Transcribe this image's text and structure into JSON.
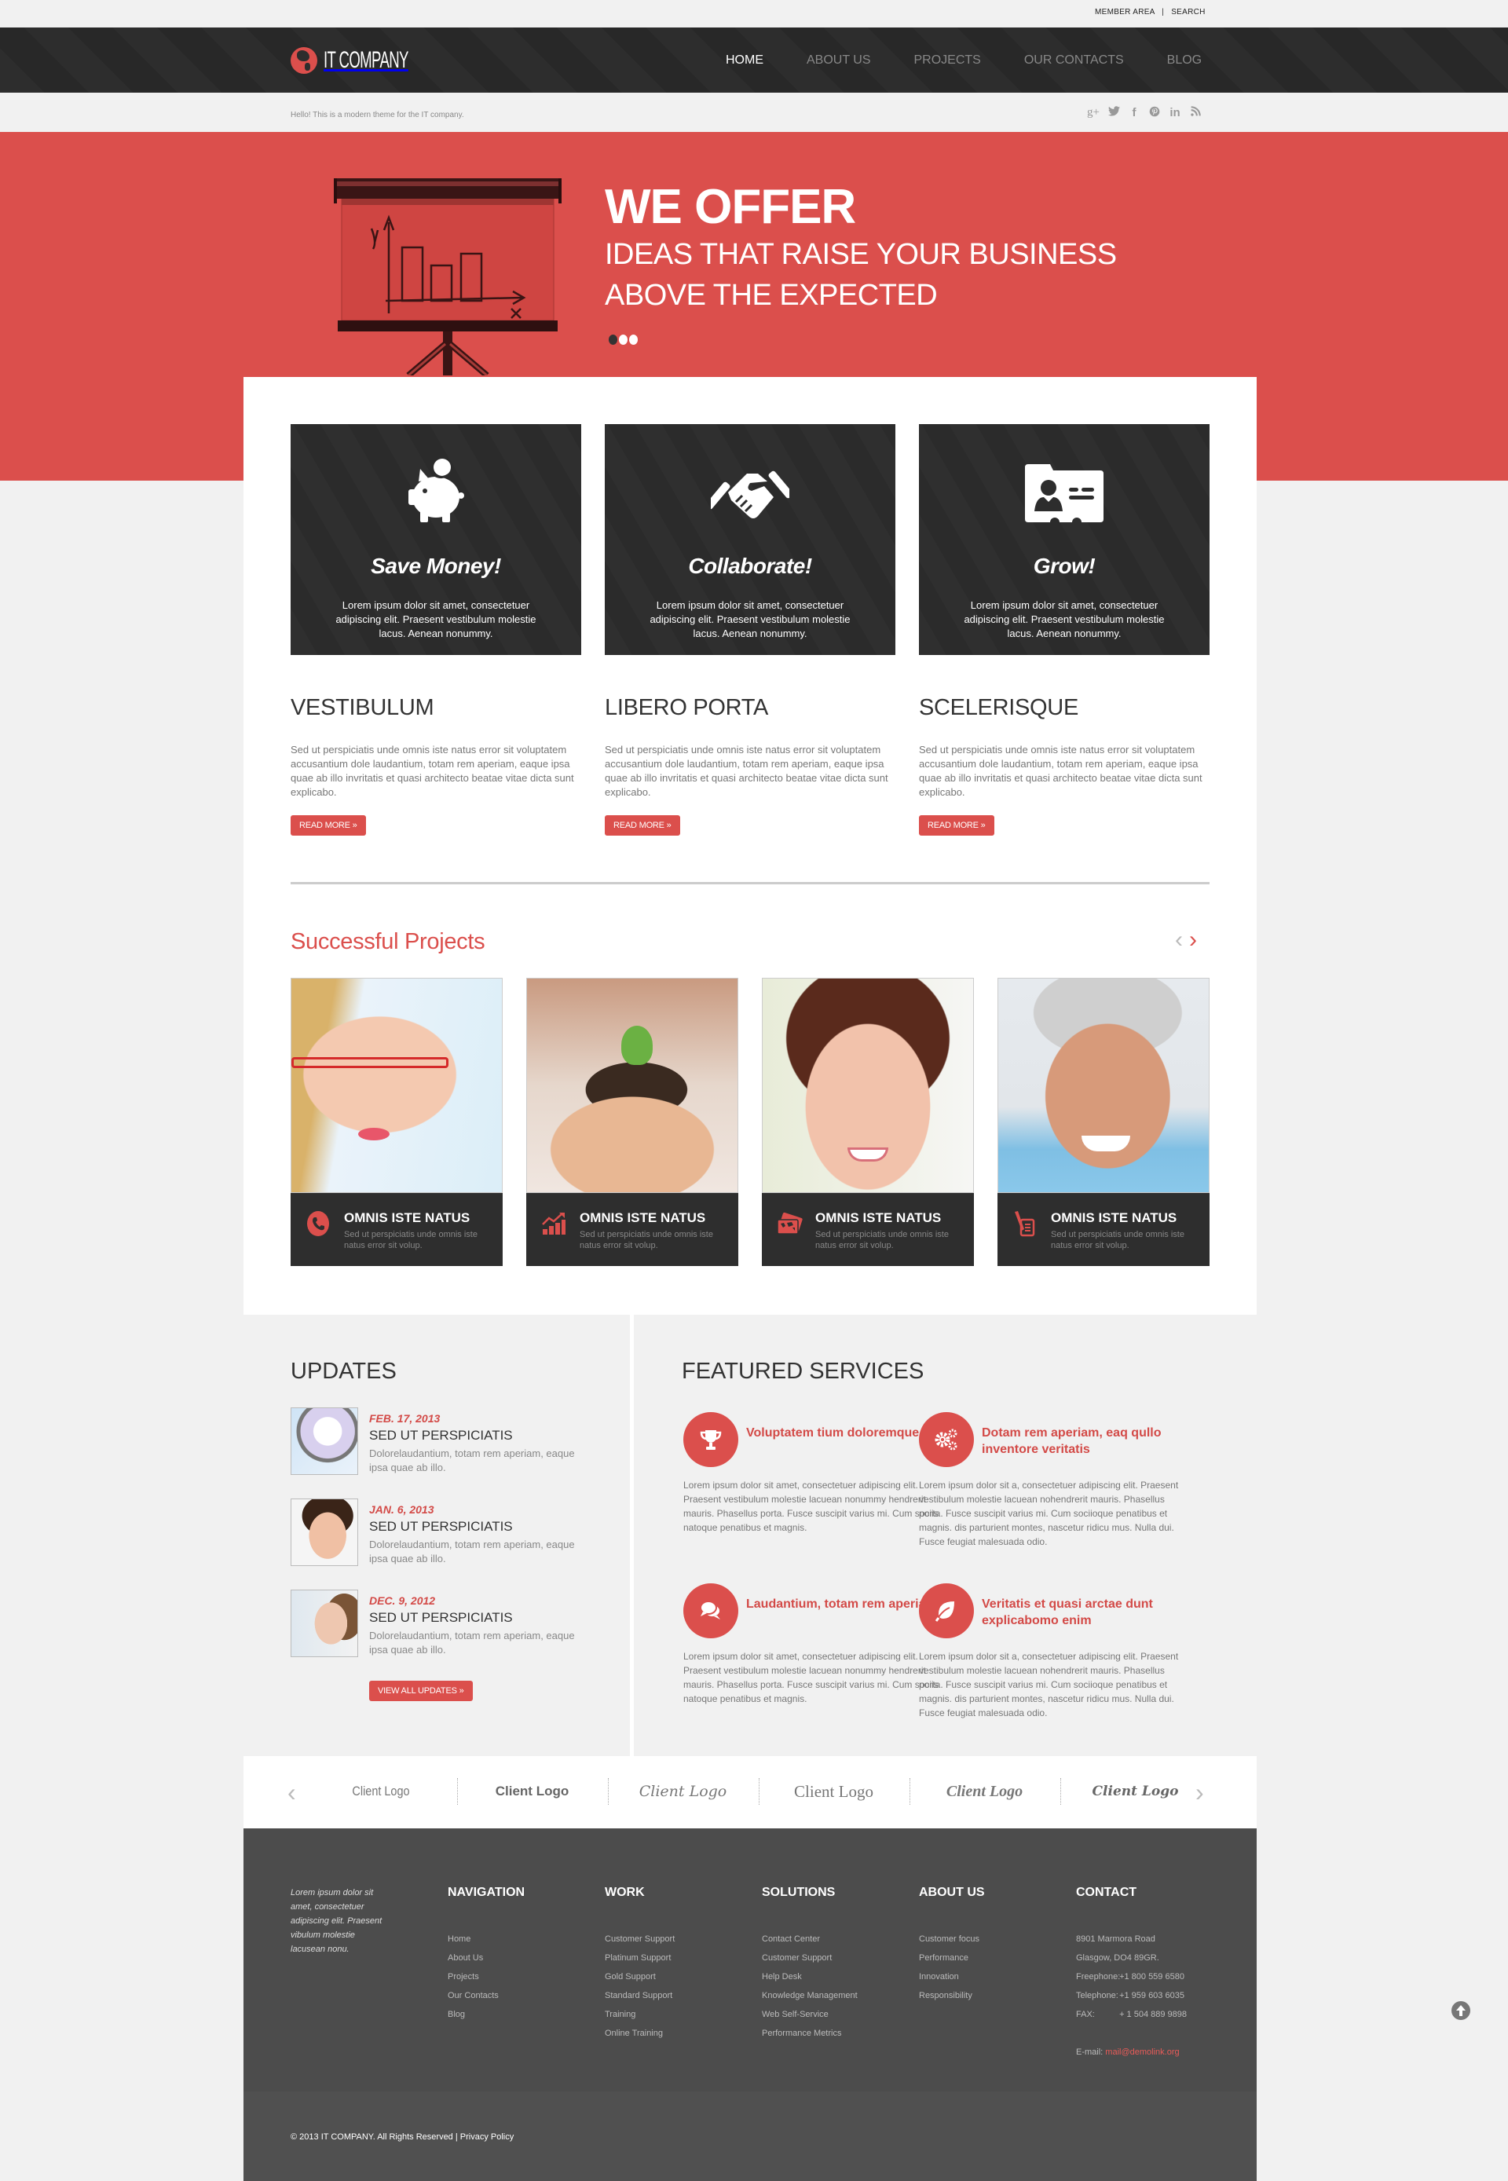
{
  "top_links": {
    "member_area": "MEMBER AREA",
    "separator": "|",
    "search": "SEARCH"
  },
  "header": {
    "logo_text": "IT COMPANY",
    "nav": [
      {
        "label": "HOME",
        "active": true
      },
      {
        "label": "ABOUT US",
        "active": false
      },
      {
        "label": "PROJECTS",
        "active": false
      },
      {
        "label": "OUR CONTACTS",
        "active": false
      },
      {
        "label": "BLOG",
        "active": false
      }
    ],
    "tagline": "Hello! This is a modern theme for the IT company.",
    "social": [
      {
        "icon": "google-plus-icon",
        "glyph": "g+"
      },
      {
        "icon": "twitter-icon",
        "glyph": "t"
      },
      {
        "icon": "facebook-icon",
        "glyph": "f"
      },
      {
        "icon": "pinterest-icon",
        "glyph": "p"
      },
      {
        "icon": "linkedin-icon",
        "glyph": "in"
      },
      {
        "icon": "rss-icon",
        "glyph": "☷"
      }
    ]
  },
  "hero": {
    "title": "WE OFFER",
    "subtitle_line1": "IDEAS THAT RAISE YOUR BUSINESS",
    "subtitle_line2": "ABOVE THE EXPECTED",
    "slides": 3,
    "active_slide": 1
  },
  "features": [
    {
      "icon": "piggy-bank-icon",
      "title": "Save Money!",
      "text": "Lorem ipsum dolor sit amet, consectetuer adipiscing elit. Praesent vestibulum molestie lacus. Aenean nonummy."
    },
    {
      "icon": "handshake-icon",
      "title": "Collaborate!",
      "text": "Lorem ipsum dolor sit amet, consectetuer adipiscing elit. Praesent vestibulum molestie lacus. Aenean nonummy."
    },
    {
      "icon": "id-card-icon",
      "title": "Grow!",
      "text": "Lorem ipsum dolor sit amet, consectetuer adipiscing elit. Praesent vestibulum molestie lacus. Aenean nonummy."
    }
  ],
  "info_columns": [
    {
      "title": "VESTIBULUM",
      "text": "Sed ut perspiciatis unde omnis iste natus error sit voluptatem accusantium dole laudantium, totam rem aperiam, eaque ipsa quae ab illo invritatis et quasi architecto beatae vitae dicta sunt explicabo.",
      "button": "READ MORE »"
    },
    {
      "title": "LIBERO PORTA",
      "text": "Sed ut perspiciatis unde omnis iste natus error sit voluptatem accusantium dole laudantium, totam rem aperiam, eaque ipsa quae ab illo invritatis et quasi architecto beatae vitae dicta sunt explicabo.",
      "button": "READ MORE »"
    },
    {
      "title": "SCELERISQUE",
      "text": "Sed ut perspiciatis unde omnis iste natus error sit voluptatem accusantium dole laudantium, totam rem aperiam, eaque ipsa quae ab illo invritatis et quasi architecto beatae vitae dicta sunt explicabo.",
      "button": "READ MORE »"
    }
  ],
  "projects": {
    "title": "Successful Projects",
    "prev": "‹",
    "next": "›",
    "items": [
      {
        "photo": "woman-with-red-glasses",
        "icon": "phone-icon",
        "title": "OMNIS ISTE NATUS",
        "text": "Sed ut perspiciatis unde omnis iste natus error sit volup."
      },
      {
        "photo": "hands-holding-sprout",
        "icon": "growth-chart-icon",
        "title": "OMNIS ISTE NATUS",
        "text": "Sed ut perspiciatis unde omnis iste natus error sit volup."
      },
      {
        "photo": "smiling-woman",
        "icon": "world-map-cards-icon",
        "title": "OMNIS ISTE NATUS",
        "text": "Sed ut perspiciatis unde omnis iste natus error sit volup."
      },
      {
        "photo": "smiling-senior-man",
        "icon": "pen-document-icon",
        "title": "OMNIS ISTE NATUS",
        "text": "Sed ut perspiciatis unde omnis iste natus error sit volup."
      }
    ]
  },
  "updates": {
    "title": "UPDATES",
    "items": [
      {
        "date": "FEB. 17, 2013",
        "title": "SED UT PERSPICIATIS",
        "text": "Dolorelaudantium, totam rem aperiam, eaque ipsa quae ab illo."
      },
      {
        "date": "JAN. 6, 2013",
        "title": "SED UT PERSPICIATIS",
        "text": "Dolorelaudantium, totam rem aperiam, eaque ipsa quae ab illo."
      },
      {
        "date": "DEC. 9, 2012",
        "title": "SED UT PERSPICIATIS",
        "text": "Dolorelaudantium, totam rem aperiam, eaque ipsa quae ab illo."
      }
    ],
    "button": "VIEW ALL UPDATES »"
  },
  "services": {
    "title": "FEATURED SERVICES",
    "items": [
      {
        "icon": "trophy-icon",
        "title": "Voluptatem tium doloremque",
        "text": "Lorem ipsum dolor sit amet, consectetuer adipiscing elit. Praesent vestibulum molestie lacuean nonummy hendrerit mauris. Phasellus porta. Fusce suscipit varius mi. Cum sociis natoque penatibus et magnis."
      },
      {
        "icon": "gears-icon",
        "title": "Dotam rem aperiam, eaq qullo inventore veritatis",
        "text": "Lorem ipsum dolor sit a, consectetuer adipiscing elit. Praesent vestibulum molestie lacuean nohendrerit mauris. Phasellus porta. Fusce suscipit varius mi. Cum sociioque penatibus et magnis. dis parturient montes, nascetur ridicu mus. Nulla dui. Fusce feugiat malesuada odio."
      },
      {
        "icon": "chat-bubbles-icon",
        "title": "Laudantium, totam rem aperiam",
        "text": "Lorem ipsum dolor sit amet, consectetuer adipiscing elit. Praesent vestibulum molestie lacuean nonummy hendrerit mauris. Phasellus porta. Fusce suscipit varius mi. Cum sociis natoque penatibus et magnis."
      },
      {
        "icon": "leaf-icon",
        "title": "Veritatis et quasi arctae dunt explicabomo enim",
        "text": "Lorem ipsum dolor sit a, consectetuer adipiscing elit. Praesent vestibulum molestie lacuean nohendrerit mauris. Phasellus porta. Fusce suscipit varius mi. Cum sociioque penatibus et magnis. dis parturient montes, nascetur ridicu mus. Nulla dui. Fusce feugiat malesuada odio."
      }
    ]
  },
  "clients": {
    "prev": "‹",
    "next": "›",
    "logos": [
      "Client Logo",
      "Client Logo",
      "Client Logo",
      "Client Logo",
      "Client Logo",
      "Client Logo"
    ]
  },
  "footer": {
    "intro": "Lorem ipsum dolor sit amet, consectetuer adipiscing elit. Praesent vibulum molestie lacusean nonu.",
    "columns": [
      {
        "title": "NAVIGATION",
        "links": [
          "Home",
          "About Us",
          "Projects",
          "Our Contacts",
          "Blog"
        ]
      },
      {
        "title": "WORK",
        "links": [
          "Customer Support",
          "Platinum Support",
          "Gold Support",
          "Standard Support",
          "Training",
          "Online Training"
        ]
      },
      {
        "title": "SOLUTIONS",
        "links": [
          "Contact Center",
          "Customer Support",
          "Help Desk",
          "Knowledge Management",
          "Web Self-Service",
          "Performance Metrics"
        ]
      },
      {
        "title": "ABOUT US",
        "links": [
          "Customer focus",
          "Performance",
          "Innovation",
          "Responsibility"
        ]
      }
    ],
    "contact": {
      "title": "CONTACT",
      "address1": "8901 Marmora Road",
      "address2": "Glasgow, DO4 89GR.",
      "freephone_label": "Freephone:",
      "freephone": "+1 800 559 6580",
      "telephone_label": "Telephone:",
      "telephone": "+1 959 603 6035",
      "fax_label": "FAX:",
      "fax": "+ 1 504 889 9898",
      "email_label": "E-mail:",
      "email": "mail@demolink.org"
    },
    "copyright": "© 2013 IT COMPANY. All Rights Reserved |",
    "privacy": "Privacy Policy"
  },
  "colors": {
    "accent": "#db4f4c",
    "dark": "#2d2d2d",
    "footer": "#4c4c4c",
    "page_bg": "#f1f1f1"
  }
}
